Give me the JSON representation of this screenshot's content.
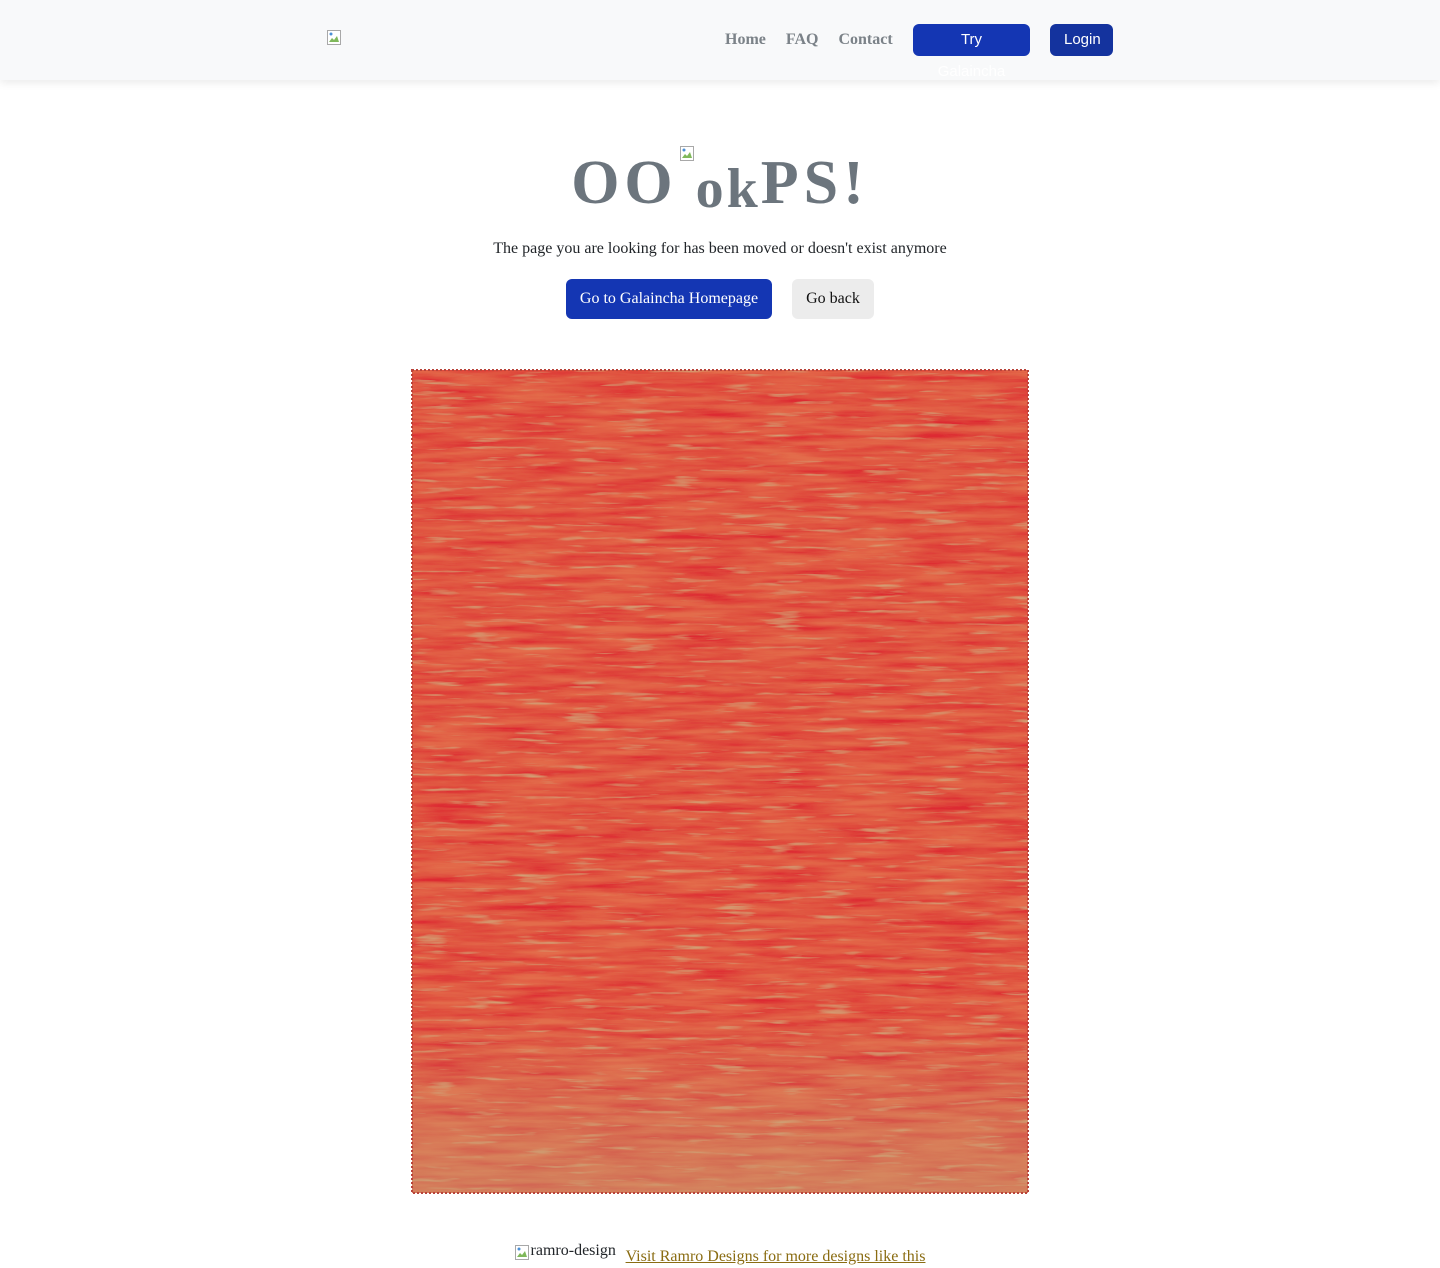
{
  "nav": {
    "links": [
      "Home",
      "FAQ",
      "Contact"
    ],
    "try_label": "Try Galaincha",
    "login_label": "Login"
  },
  "error": {
    "heading_left": "OO",
    "heading_mid": "ok",
    "heading_right": "PS!",
    "message": "The page you are looking for has been moved or doesn't exist anymore",
    "home_button": "Go to Galaincha Homepage",
    "back_button": "Go back"
  },
  "footer": {
    "image_alt": "ramro-design",
    "link_text": "Visit Ramro Designs for more designs like this"
  },
  "colors": {
    "brand_blue": "#1436b3",
    "rug_red": "#dd2a33",
    "rug_orange": "#e36c4c",
    "rug_gold": "#c9a072",
    "link_gold": "#8a6c12"
  }
}
